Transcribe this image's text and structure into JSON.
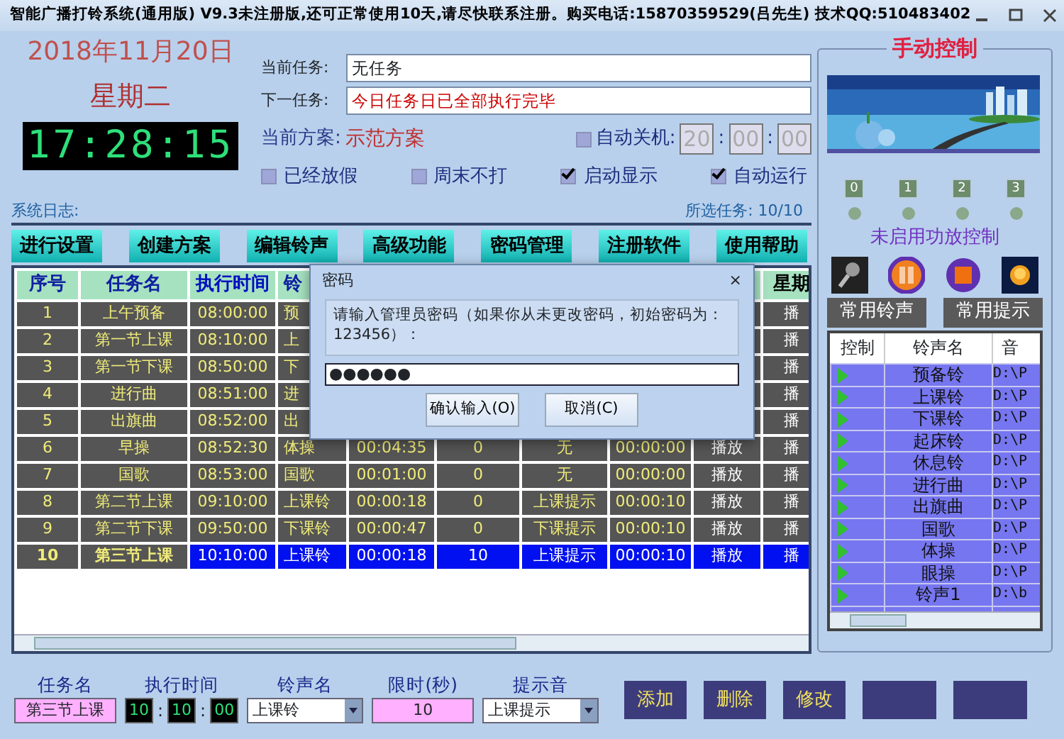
{
  "window": {
    "title": "智能广播打铃系统(通用版) V9.3未注册版,还可正常使用10天,请尽快联系注册。购买电话:15870359529(吕先生) 技术QQ:510483402"
  },
  "date": "2018年11月20日",
  "weekday": "星期二",
  "clock": "17:28:15",
  "current_task": {
    "label": "当前任务:",
    "value": "无任务"
  },
  "next_task": {
    "label": "下一任务:",
    "value": "今日任务日已全部执行完毕"
  },
  "plan": {
    "label": "当前方案:",
    "value": "示范方案"
  },
  "auto_shutdown": {
    "label": "自动关机:",
    "checked": false,
    "hour": "20",
    "minute": "00",
    "second": "00",
    "separator": ":"
  },
  "options": [
    {
      "label": "已经放假",
      "checked": false
    },
    {
      "label": "周末不打",
      "checked": false
    },
    {
      "label": "启动显示",
      "checked": true
    },
    {
      "label": "自动运行",
      "checked": true
    }
  ],
  "log_label": "系统日志:",
  "selected_count": "所选任务: 10/10",
  "toolbar": [
    "进行设置",
    "创建方案",
    "编辑铃声",
    "高级功能",
    "密码管理",
    "注册软件",
    "使用帮助"
  ],
  "table": {
    "columns": [
      "序号",
      "任务名",
      "执行时间",
      "铃"
    ],
    "last_column": "星期",
    "rows": [
      {
        "selected": false,
        "cells": [
          "1",
          "上午预备",
          "08:00:00",
          "预"
        ],
        "last": "播"
      },
      {
        "selected": false,
        "cells": [
          "2",
          "第一节上课",
          "08:10:00",
          "上"
        ],
        "last": "播"
      },
      {
        "selected": false,
        "cells": [
          "3",
          "第一节下课",
          "08:50:00",
          "下"
        ],
        "last": "播"
      },
      {
        "selected": false,
        "cells": [
          "4",
          "进行曲",
          "08:51:00",
          "进"
        ],
        "last": "播"
      },
      {
        "selected": false,
        "cells": [
          "5",
          "出旗曲",
          "08:52:00",
          "出"
        ],
        "last": "播"
      },
      {
        "selected": false,
        "cells": [
          "6",
          "早操",
          "08:52:30",
          "体操",
          "00:04:35",
          "0",
          "无",
          "00:00:00",
          "播放"
        ],
        "last": "播"
      },
      {
        "selected": false,
        "cells": [
          "7",
          "国歌",
          "08:53:00",
          "国歌",
          "00:01:00",
          "0",
          "无",
          "00:00:00",
          "播放"
        ],
        "last": "播"
      },
      {
        "selected": false,
        "cells": [
          "8",
          "第二节上课",
          "09:10:00",
          "上课铃",
          "00:00:18",
          "0",
          "上课提示",
          "00:00:10",
          "播放"
        ],
        "last": "播"
      },
      {
        "selected": false,
        "cells": [
          "9",
          "第二节下课",
          "09:50:00",
          "下课铃",
          "00:00:47",
          "0",
          "下课提示",
          "00:00:10",
          "播放"
        ],
        "last": "播"
      },
      {
        "selected": true,
        "cells": [
          "10",
          "第三节上课",
          "10:10:00",
          "上课铃",
          "00:00:18",
          "10",
          "上课提示",
          "00:00:10",
          "播放"
        ],
        "last": "播"
      }
    ]
  },
  "dialog": {
    "title": "密码",
    "close": "×",
    "message": "请输入管理员密码（如果你从未更改密码，初始密码为：123456）：",
    "password": "●●●●●●",
    "buttons": [
      "确认输入(O)",
      "取消(C)"
    ]
  },
  "manual": {
    "title": "手动控制",
    "channels": [
      {
        "label": "0",
        "on": false
      },
      {
        "label": "1",
        "on": false
      },
      {
        "label": "2",
        "on": false
      },
      {
        "label": "3",
        "on": false
      }
    ],
    "status": "未启用功放控制",
    "tabs": [
      "常用铃声",
      "常用提示"
    ],
    "columns": [
      "控制",
      "铃声名",
      "音"
    ],
    "bells": [
      {
        "name": "预备铃",
        "path": "D:\\P"
      },
      {
        "name": "上课铃",
        "path": "D:\\P"
      },
      {
        "name": "下课铃",
        "path": "D:\\P"
      },
      {
        "name": "起床铃",
        "path": "D:\\P"
      },
      {
        "name": "休息铃",
        "path": "D:\\P"
      },
      {
        "name": "进行曲",
        "path": "D:\\P"
      },
      {
        "name": "出旗曲",
        "path": "D:\\P"
      },
      {
        "name": "国歌",
        "path": "D:\\P"
      },
      {
        "name": "体操",
        "path": "D:\\P"
      },
      {
        "name": "眼操",
        "path": "D:\\P"
      },
      {
        "name": "铃声1",
        "path": "D:\\b"
      }
    ]
  },
  "form": {
    "labels": [
      "任务名",
      "执行时间",
      "铃声名",
      "限时(秒)",
      "提示音"
    ],
    "name": "第三节上课",
    "hour": "10",
    "minute": "10",
    "second": "00",
    "separator": ":",
    "bell": "上课铃",
    "limit": "10",
    "prompt": "上课提示",
    "buttons": [
      "添加",
      "删除",
      "修改"
    ]
  }
}
